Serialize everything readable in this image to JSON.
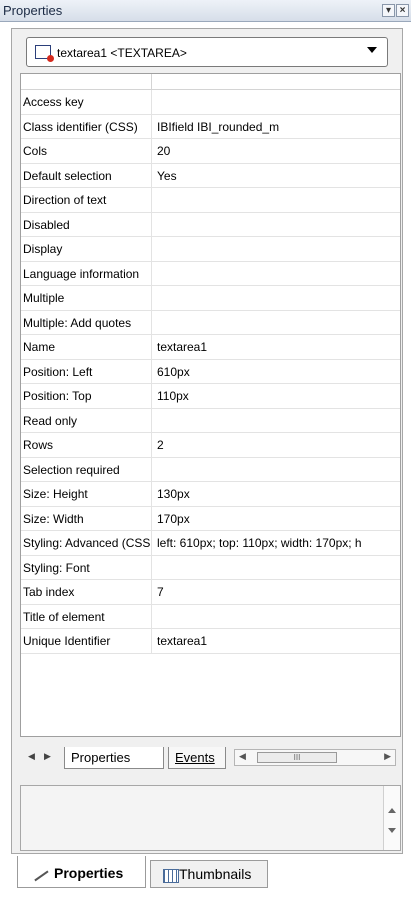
{
  "window": {
    "title": "Properties"
  },
  "element_selector": {
    "selected": "textarea1 <TEXTAREA>",
    "icon": "textarea-element-icon"
  },
  "properties": [
    {
      "key": "Access key",
      "value": ""
    },
    {
      "key": "Class identifier (CSS)",
      "value": "IBIfield IBI_rounded_m"
    },
    {
      "key": "Cols",
      "value": "20"
    },
    {
      "key": "Default selection",
      "value": "Yes"
    },
    {
      "key": "Direction of text",
      "value": ""
    },
    {
      "key": "Disabled",
      "value": ""
    },
    {
      "key": "Display",
      "value": ""
    },
    {
      "key": "Language information",
      "value": ""
    },
    {
      "key": "Multiple",
      "value": ""
    },
    {
      "key": "Multiple: Add quotes",
      "value": ""
    },
    {
      "key": "Name",
      "value": "textarea1"
    },
    {
      "key": "Position: Left",
      "value": "610px"
    },
    {
      "key": "Position: Top",
      "value": "110px"
    },
    {
      "key": "Read only",
      "value": ""
    },
    {
      "key": "Rows",
      "value": "2"
    },
    {
      "key": "Selection required",
      "value": ""
    },
    {
      "key": "Size: Height",
      "value": "130px"
    },
    {
      "key": "Size: Width",
      "value": "170px"
    },
    {
      "key": "Styling: Advanced (CSS)",
      "value": "left: 610px; top: 110px; width: 170px; h"
    },
    {
      "key": "Styling: Font",
      "value": ""
    },
    {
      "key": "Tab index",
      "value": "7"
    },
    {
      "key": "Title of element",
      "value": ""
    },
    {
      "key": "Unique Identifier",
      "value": "textarea1"
    }
  ],
  "inner_tabs": {
    "properties": "Properties",
    "events": "Events",
    "scroll_thumb": "III"
  },
  "bottom_tabs": {
    "properties": "Properties",
    "thumbnails": "Thumbnails"
  }
}
